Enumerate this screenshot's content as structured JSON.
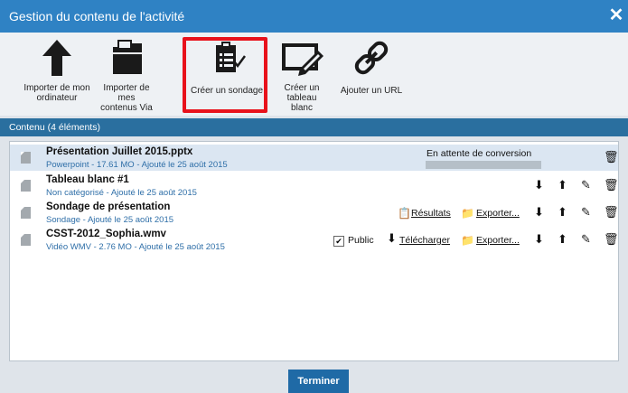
{
  "dialog": {
    "title": "Gestion du contenu de l'activité",
    "close": "✕"
  },
  "toolbar": {
    "items": [
      {
        "label1": "Importer de mon",
        "label2": "ordinateur",
        "icon": "upload-arrow-icon"
      },
      {
        "label1": "Importer de mes",
        "label2": "contenus Via",
        "icon": "folder-icon"
      },
      {
        "label1": "Créer un sondage",
        "label2": "",
        "icon": "clipboard-check-icon"
      },
      {
        "label1": "Créer un tableau",
        "label2": "blanc",
        "icon": "whiteboard-icon"
      },
      {
        "label1": "Ajouter un URL",
        "label2": "",
        "icon": "link-icon"
      }
    ]
  },
  "content": {
    "header": "Contenu (4 éléments)",
    "rows": [
      {
        "title": "Présentation Juillet 2015.pptx",
        "meta": "Powerpoint - 17.61 MO - Ajouté le 25 août 2015",
        "status": "En attente de conversion",
        "progress": 0
      },
      {
        "title": "Tableau blanc #1",
        "meta": "Non catégorisé - Ajouté le 25 août 2015"
      },
      {
        "title": "Sondage de présentation",
        "meta": "Sondage - Ajouté le 25 août 2015",
        "results": "Résultats",
        "export": "Exporter..."
      },
      {
        "title": "CSST-2012_Sophia.wmv",
        "meta": "Vidéo WMV - 2.76 MO - Ajouté le 25 août 2015",
        "public": "Public",
        "download": "Télécharger",
        "export": "Exporter..."
      }
    ]
  },
  "footer": {
    "button": "Terminer"
  },
  "colors": {
    "titlebar": "#2f82c4",
    "section": "#2a6f9f",
    "highlight": "#e8121b",
    "link_meta": "#2f6fa8"
  }
}
